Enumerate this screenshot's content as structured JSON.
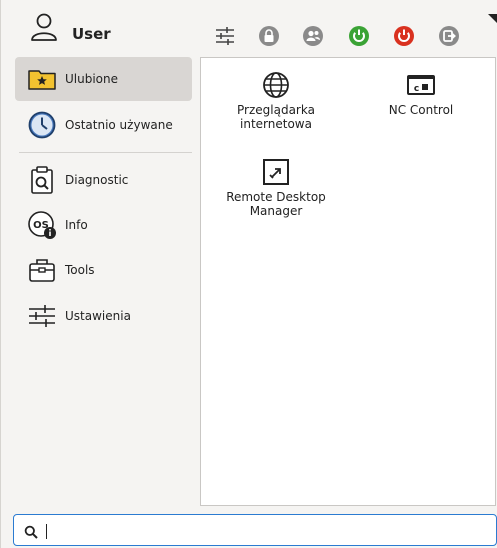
{
  "header": {
    "user_name": "User",
    "buttons": [
      {
        "name": "settings-sliders-icon",
        "color": "#444444"
      },
      {
        "name": "lock-icon",
        "color": "#8a8a8a"
      },
      {
        "name": "switch-user-icon",
        "color": "#8a8a8a"
      },
      {
        "name": "restart-icon",
        "color": "#3aa335"
      },
      {
        "name": "power-icon",
        "color": "#d9311f"
      },
      {
        "name": "logout-icon",
        "color": "#8a8a8a"
      }
    ]
  },
  "sidebar": {
    "items": [
      {
        "label": "Ulubione",
        "icon": "favorites-folder-icon",
        "active": true
      },
      {
        "label": "Ostatnio używane",
        "icon": "clock-icon",
        "active": false
      },
      {
        "label": "Diagnostic",
        "icon": "clipboard-search-icon",
        "active": false
      },
      {
        "label": "Info",
        "icon": "os-info-icon",
        "active": false
      },
      {
        "label": "Tools",
        "icon": "toolbox-icon",
        "active": false
      },
      {
        "label": "Ustawienia",
        "icon": "settings-sliders-icon",
        "active": false
      }
    ]
  },
  "apps": [
    {
      "label_line1": "Przeglądarka",
      "label_line2": "internetowa",
      "icon": "globe-icon"
    },
    {
      "label_line1": "NC Control",
      "label_line2": "",
      "icon": "nc-control-icon"
    },
    {
      "label_line1": "Remote Desktop",
      "label_line2": "Manager",
      "icon": "remote-desktop-icon"
    }
  ],
  "search": {
    "value": "",
    "placeholder": ""
  },
  "colors": {
    "accent": "#2b7bd1",
    "active_bg": "#d9d6d3",
    "folder": "#f2c230"
  }
}
